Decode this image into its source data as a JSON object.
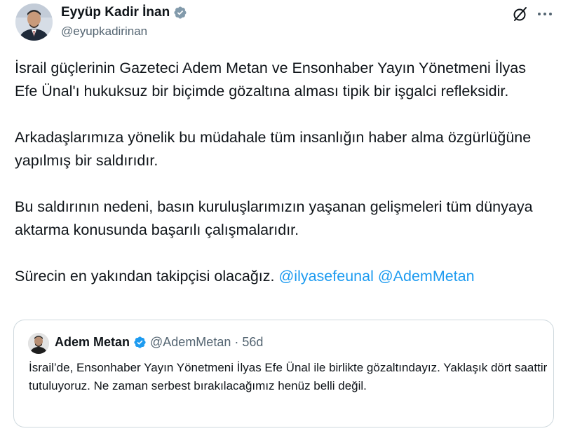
{
  "author": {
    "display_name": "Eyyüp Kadir İnan",
    "handle": "@eyupkadirinan",
    "verified": true
  },
  "tweet": {
    "paragraphs": [
      "İsrail güçlerinin Gazeteci Adem Metan ve Ensonhaber Yayın Yönetmeni İlyas Efe Ünal'ı hukuksuz bir biçimde gözaltına alması tipik bir işgalci refleksidir.",
      "Arkadaşlarımıza yönelik bu müdahale tüm insanlığın haber alma özgürlüğüne yapılmış bir saldırıdır.",
      "Bu saldırının nedeni, basın kuruluşlarımızın yaşanan gelişmeleri tüm dünyaya aktarma konusunda başarılı çalışmalarıdır."
    ],
    "last_paragraph_text": "Sürecin en yakından takipçisi olacağız. ",
    "mentions": [
      "@ilyasefeunal",
      "@AdemMetan"
    ]
  },
  "quoted": {
    "display_name": "Adem Metan",
    "handle": "@AdemMetan",
    "separator": "·",
    "time": "56d",
    "verified": true,
    "text": "İsrail’de, Ensonhaber Yayın Yönetmeni İlyas Efe Ünal ile birlikte gözaltındayız. Yaklaşık dört saattir tutuluyoruz. Ne zaman serbest bırakılacağımız henüz belli değil."
  },
  "icons": {
    "verified": "verified-badge-icon",
    "grok": "grok-icon",
    "more": "more-options-icon"
  },
  "colors": {
    "accent": "#1d9bf0",
    "text": "#0f1419",
    "secondary": "#536471",
    "border": "#cfd9de"
  }
}
